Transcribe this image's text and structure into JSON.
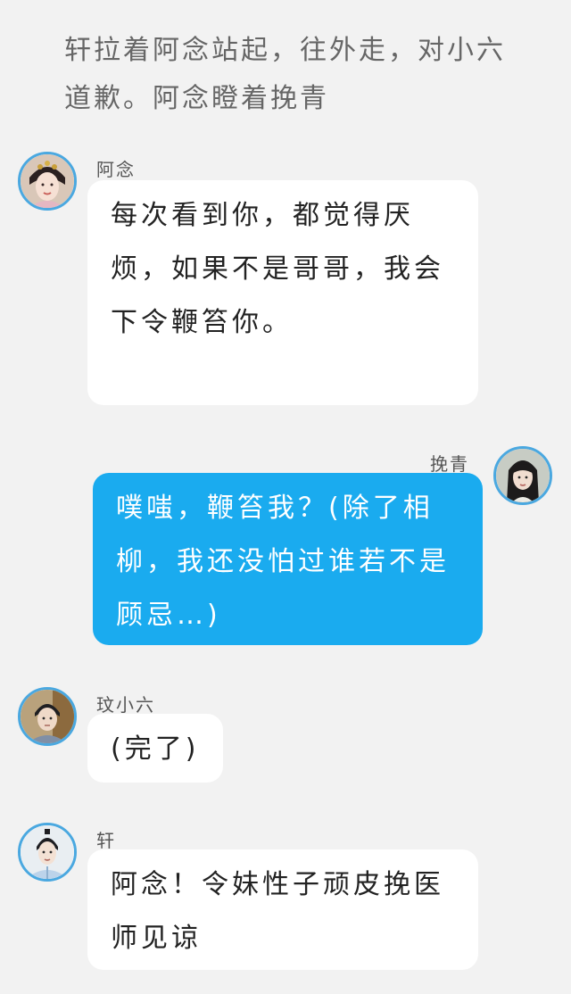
{
  "narration": "轩拉着阿念站起，往外走，对小六道歉。阿念瞪着挽青",
  "messages": [
    {
      "sender": "阿念",
      "avatar_icon": "woman-headdress-avatar",
      "side": "left",
      "style": "white",
      "text": "每次看到你，都觉得厌烦，如果不是哥哥，我会下令鞭笞你。"
    },
    {
      "sender": "挽青",
      "avatar_icon": "woman-long-hair-avatar",
      "side": "right",
      "style": "blue",
      "text": "噗嗤，鞭笞我？(除了相柳，我还没怕过谁若不是顾忌…)"
    },
    {
      "sender": "玟小六",
      "avatar_icon": "young-man-avatar",
      "side": "left",
      "style": "white",
      "text": "(完了)"
    },
    {
      "sender": "轩",
      "avatar_icon": "man-light-robe-avatar",
      "side": "left",
      "style": "white",
      "text": "阿念！令妹性子顽皮挽医师见谅"
    }
  ],
  "colors": {
    "background": "#f2f2f2",
    "bubble_white": "#ffffff",
    "bubble_blue": "#1aabef",
    "avatar_ring": "#4aa8e0",
    "narration_text": "#666666"
  }
}
